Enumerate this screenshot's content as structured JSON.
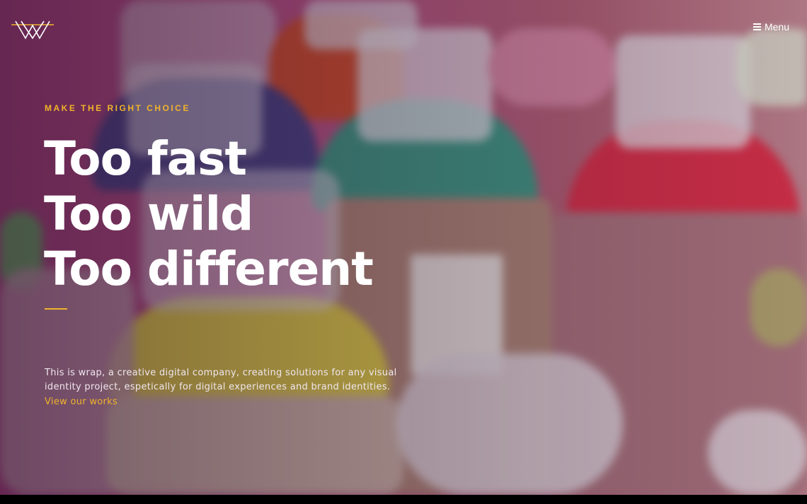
{
  "header": {
    "logo_icon": "triangle-w-logo-icon",
    "menu_icon": "hamburger-icon",
    "menu_label": "Menu"
  },
  "hero": {
    "eyebrow": "MAKE THE RIGHT CHOICE",
    "headline_lines": [
      "Too fast",
      "Too wild",
      "Too different"
    ],
    "description": "This is wrap, a creative digital company, creating solutions for any visual identity project, espetically for digital experiences and brand identities.",
    "link_label": "View our works"
  },
  "colors": {
    "accent": "#f0b32b",
    "text": "#ffffff",
    "background_tint": "#b04a84"
  }
}
